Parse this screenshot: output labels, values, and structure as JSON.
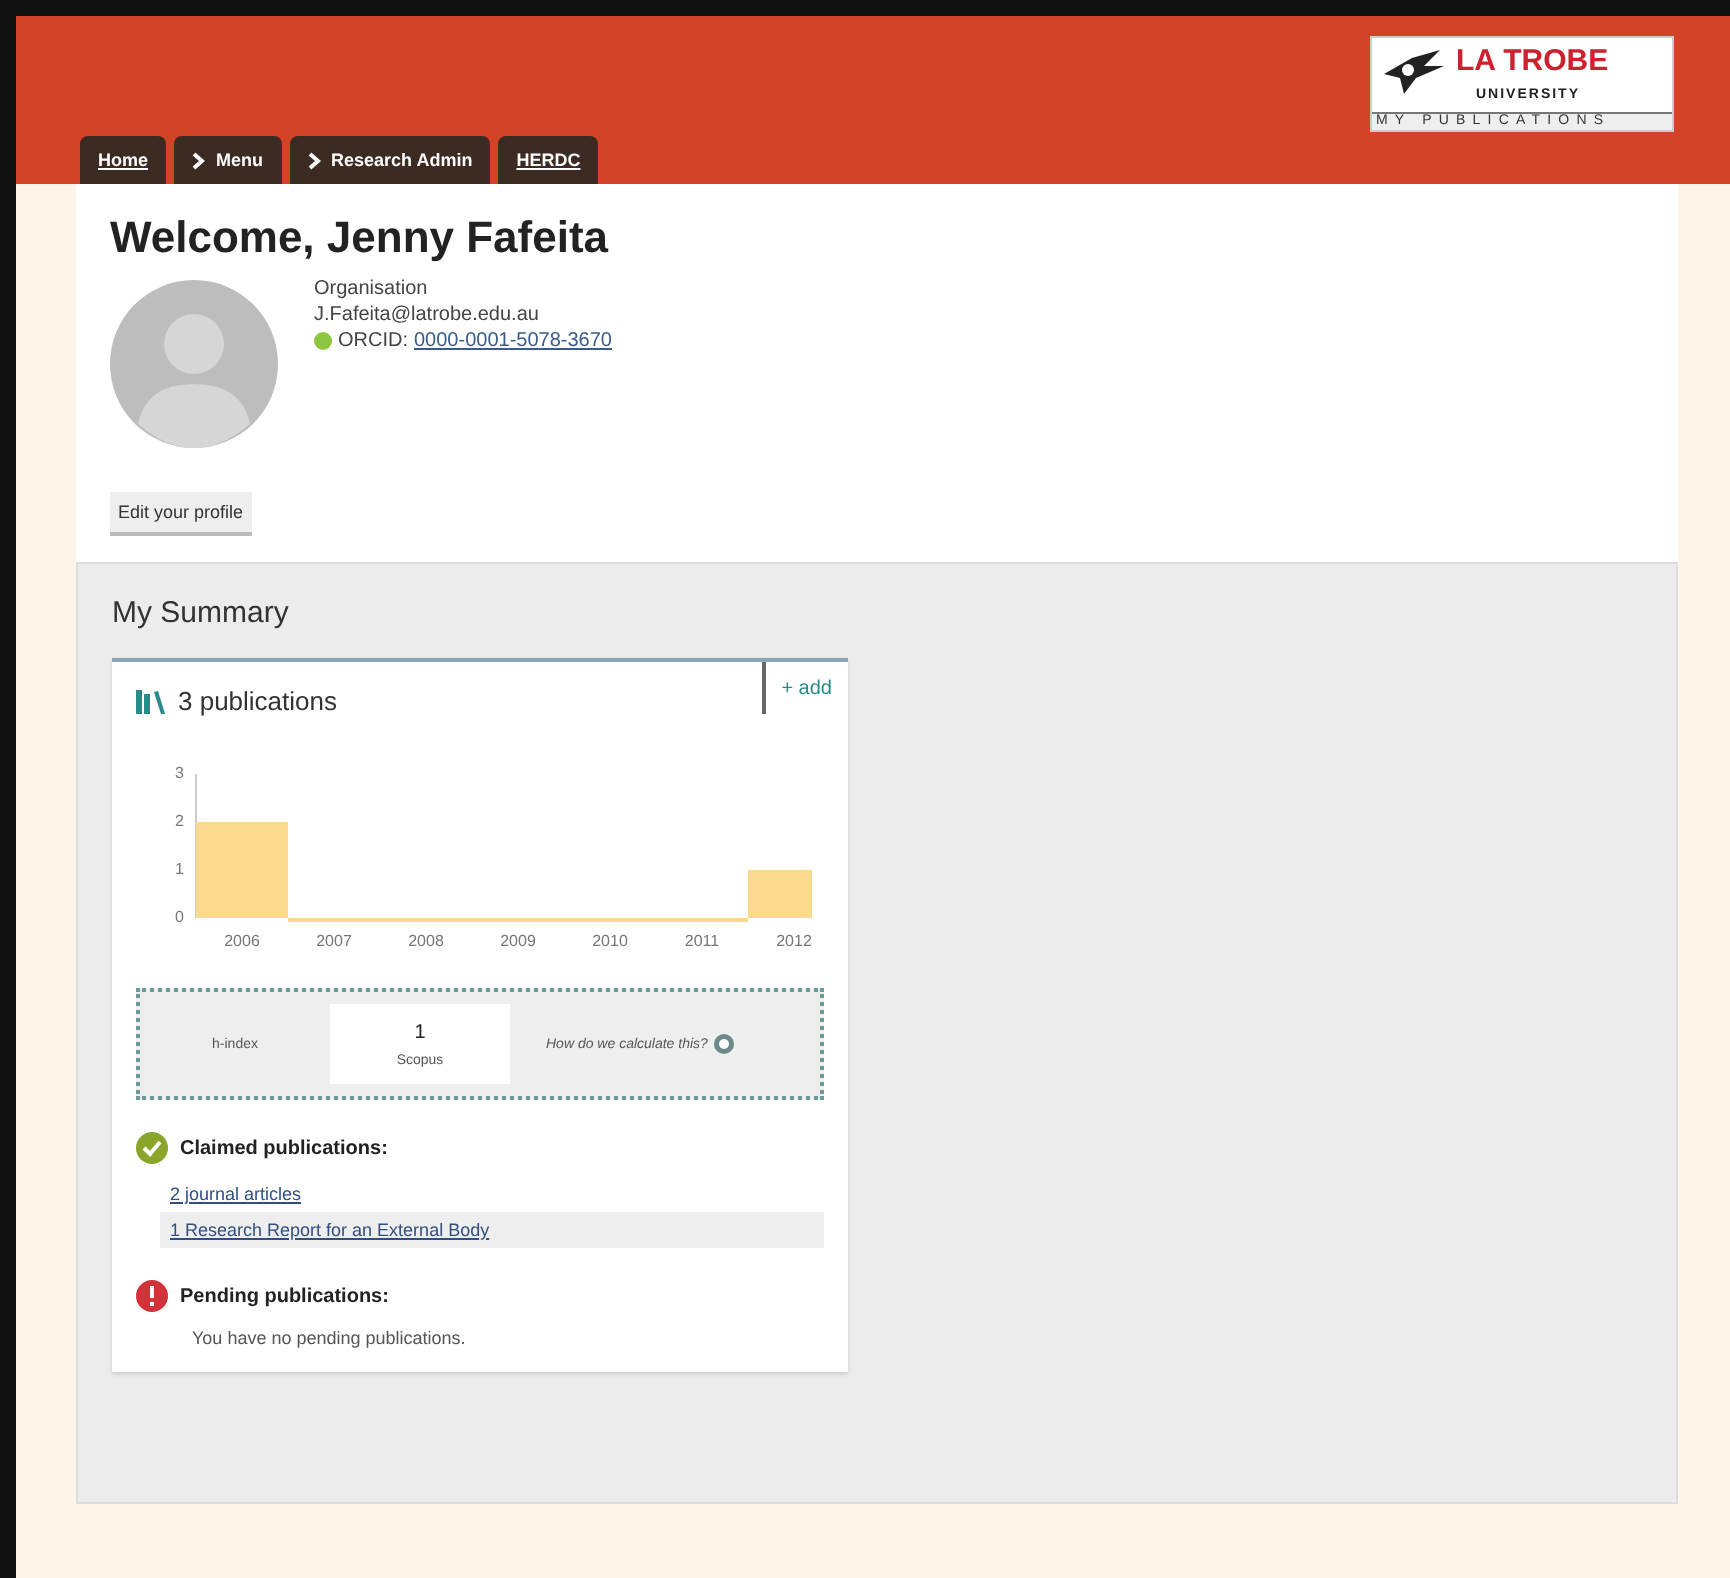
{
  "breadcrumbs": [
    {
      "label": "Home",
      "kind": "link"
    },
    {
      "label": "Menu",
      "kind": "menu"
    },
    {
      "label": "Research Admin",
      "kind": "menu"
    },
    {
      "label": "HERDC",
      "kind": "link"
    }
  ],
  "logo": {
    "name": "LA TROBE",
    "subname": "UNIVERSITY",
    "tagline": "MY PUBLICATIONS"
  },
  "profile": {
    "heading": "Welcome, Jenny Fafeita",
    "organisation": "Organisation",
    "email": "J.Fafeita@latrobe.edu.au",
    "orcid_label": "ORCID:",
    "orcid": "0000-0001-5078-3670",
    "edit_button": "Edit your profile"
  },
  "summary": {
    "title": "My Summary",
    "count": "3 publications",
    "add": "+ add",
    "chart_data": {
      "type": "bar",
      "categories": [
        "2006",
        "2007",
        "2008",
        "2009",
        "2010",
        "2011",
        "2012"
      ],
      "values": [
        2,
        0,
        0,
        0,
        0,
        0,
        1
      ],
      "ylim": [
        0,
        3
      ],
      "yticks": [
        0,
        1,
        2,
        3
      ]
    },
    "h_index": {
      "label": "h-index",
      "value": "1",
      "source": "Scopus",
      "help": "How do we calculate this?"
    },
    "claimed": {
      "title": "Claimed publications:",
      "links": [
        "2 journal articles",
        "1 Research Report for an External Body"
      ]
    },
    "pending": {
      "title": "Pending publications:",
      "message": "You have no pending publications."
    }
  }
}
